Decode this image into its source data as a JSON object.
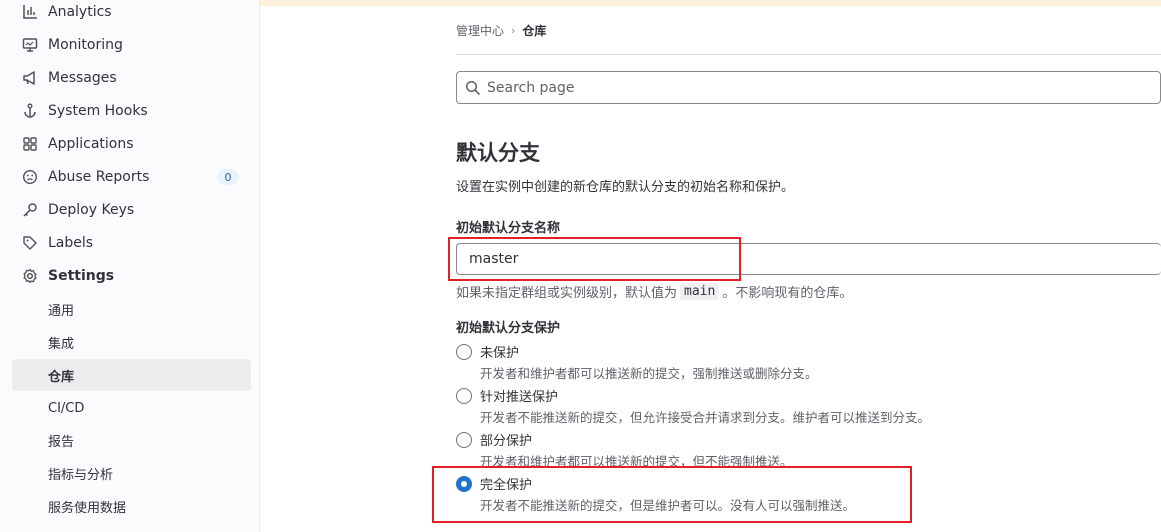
{
  "sidebar": {
    "items": [
      {
        "label": "Analytics"
      },
      {
        "label": "Monitoring"
      },
      {
        "label": "Messages"
      },
      {
        "label": "System Hooks"
      },
      {
        "label": "Applications"
      },
      {
        "label": "Abuse Reports",
        "badge": "0"
      },
      {
        "label": "Deploy Keys"
      },
      {
        "label": "Labels"
      },
      {
        "label": "Settings"
      }
    ],
    "settings_sub": [
      {
        "label": "通用"
      },
      {
        "label": "集成"
      },
      {
        "label": "仓库",
        "active": true
      },
      {
        "label": "CI/CD"
      },
      {
        "label": "报告"
      },
      {
        "label": "指标与分析"
      },
      {
        "label": "服务使用数据"
      }
    ]
  },
  "breadcrumb": {
    "parent": "管理中心",
    "current": "仓库"
  },
  "search": {
    "placeholder": "Search page"
  },
  "section": {
    "title": "默认分支",
    "description": "设置在实例中创建的新仓库的默认分支的初始名称和保护。",
    "name_label": "初始默认分支名称",
    "name_value": "master",
    "help_prefix": "如果未指定群组或实例级别，默认值为",
    "help_code": "main",
    "help_suffix": "。不影响现有的仓库。",
    "protection_label": "初始默认分支保护",
    "options": [
      {
        "label": "未保护",
        "help": "开发者和维护者都可以推送新的提交，强制推送或删除分支。",
        "checked": false
      },
      {
        "label": "针对推送保护",
        "help": "开发者不能推送新的提交，但允许接受合并请求到分支。维护者可以推送到分支。",
        "checked": false
      },
      {
        "label": "部分保护",
        "help": "开发者和维护者都可以推送新的提交，但不能强制推送。",
        "checked": false
      },
      {
        "label": "完全保护",
        "help": "开发者不能推送新的提交，但是维护者可以。没有人可以强制推送。",
        "checked": true
      }
    ]
  },
  "colors": {
    "accent": "#1f75cb",
    "highlight": "#e3202a"
  }
}
